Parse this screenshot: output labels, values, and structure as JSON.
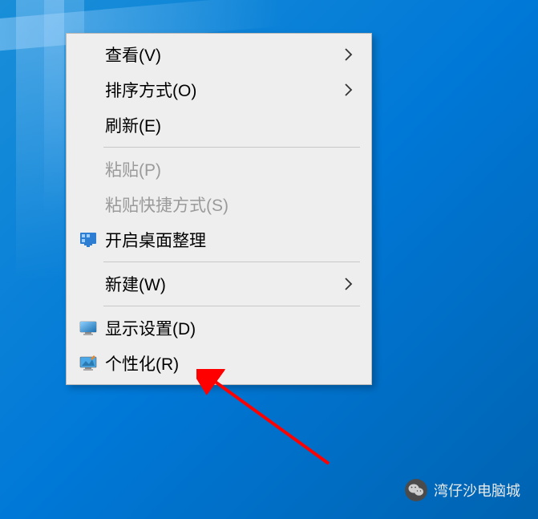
{
  "menu": {
    "items": [
      {
        "label": "查看(V)",
        "hasSubmenu": true,
        "icon": null,
        "disabled": false
      },
      {
        "label": "排序方式(O)",
        "hasSubmenu": true,
        "icon": null,
        "disabled": false
      },
      {
        "label": "刷新(E)",
        "hasSubmenu": false,
        "icon": null,
        "disabled": false
      }
    ],
    "items2": [
      {
        "label": "粘贴(P)",
        "hasSubmenu": false,
        "icon": null,
        "disabled": true
      },
      {
        "label": "粘贴快捷方式(S)",
        "hasSubmenu": false,
        "icon": null,
        "disabled": true
      },
      {
        "label": "开启桌面整理",
        "hasSubmenu": false,
        "icon": "desktop-organize",
        "disabled": false
      }
    ],
    "items3": [
      {
        "label": "新建(W)",
        "hasSubmenu": true,
        "icon": null,
        "disabled": false
      }
    ],
    "items4": [
      {
        "label": "显示设置(D)",
        "hasSubmenu": false,
        "icon": "display-settings",
        "disabled": false
      },
      {
        "label": "个性化(R)",
        "hasSubmenu": false,
        "icon": "personalize",
        "disabled": false
      }
    ]
  },
  "watermark": {
    "text": "湾仔沙电脑城"
  },
  "annotation": {
    "color": "#ff0000",
    "target": "个性化(R)"
  }
}
